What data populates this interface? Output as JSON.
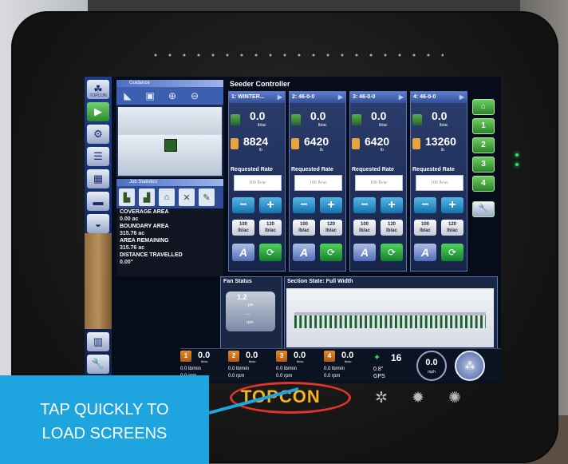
{
  "device": {
    "brand": "TOPCON"
  },
  "left_column": {
    "logo_label": "TOPCON",
    "icons": [
      "topcon-logo-icon",
      "play-icon",
      "tractor-icon",
      "map-layers-icon",
      "calculator-icon",
      "lightbar-icon",
      "tank-icon",
      "ruler-icon",
      "wrench-icon"
    ]
  },
  "guidance": {
    "title": "Guidance"
  },
  "job_stats": {
    "title": "Job Statistics",
    "rows": [
      {
        "label": "COVERAGE AREA",
        "value": "0.00 ac"
      },
      {
        "label": "BOUNDARY AREA",
        "value": "315.76 ac"
      },
      {
        "label": "AREA REMAINING",
        "value": "315.76 ac"
      },
      {
        "label": "DISTANCE TRAVELLED",
        "value": "0.00\""
      }
    ]
  },
  "seeder": {
    "title": "Seeder Controller",
    "requested_rate_label": "Requested Rate",
    "lanes": [
      {
        "name": "1: WINTER...",
        "rate": "0.0",
        "rate_unit": "lb/ac",
        "tank": "8824",
        "tank_unit": "lb",
        "placeholder": "100 lb/ac",
        "preset1": "100\nlb/ac",
        "preset2": "120\nlb/ac"
      },
      {
        "name": "2: 46-0-0",
        "rate": "0.0",
        "rate_unit": "lb/ac",
        "tank": "6420",
        "tank_unit": "lb",
        "placeholder": "100 lb/ac",
        "preset1": "100\nlb/ac",
        "preset2": "120\nlb/ac"
      },
      {
        "name": "3: 46-0-0",
        "rate": "0.0",
        "rate_unit": "lb/ac",
        "tank": "6420",
        "tank_unit": "lb",
        "placeholder": "100 lb/ac",
        "preset1": "100\nlb/ac",
        "preset2": "120\nlb/ac"
      },
      {
        "name": "4: 46-0-0",
        "rate": "0.0",
        "rate_unit": "lb/ac",
        "tank": "13260",
        "tank_unit": "lb",
        "placeholder": "100 lb/ac",
        "preset1": "100\nlb/ac",
        "preset2": "120\nlb/ac"
      }
    ],
    "right_buttons": [
      "1",
      "2",
      "3",
      "4"
    ]
  },
  "fan": {
    "title": "Fan Status",
    "pressure": "1.2",
    "pressure_unit": "psi",
    "rpm_value": "----",
    "rpm_unit": "rpm"
  },
  "section": {
    "title": "Section State: Full Width"
  },
  "status_bar": {
    "channels": [
      {
        "num": "1",
        "value": "0.0",
        "unit": "lb/ac",
        "l1": "0.0 lb/min",
        "l2": "0.0 rpm"
      },
      {
        "num": "2",
        "value": "0.0",
        "unit": "lb/ac",
        "l1": "0.0 lb/min",
        "l2": "0.0 rpm"
      },
      {
        "num": "3",
        "value": "0.0",
        "unit": "lb/ac",
        "l1": "0.0 lb/min",
        "l2": "0.0 rpm"
      },
      {
        "num": "4",
        "value": "0.0",
        "unit": "lb/ac",
        "l1": "0.0 lb/min",
        "l2": "0.0 rpm"
      }
    ],
    "satellites": "16",
    "angle": "0.8\"",
    "gps_label": "GPS",
    "speed": "0.0",
    "speed_unit": "mph"
  },
  "callout": {
    "line1": "TAP QUICKLY TO",
    "line2": "LOAD SCREENS",
    "color": "#1ea5df"
  },
  "colors": {
    "accent": "#3c5fb0",
    "highlight": "#e0342c",
    "logo": "#f5b21e"
  }
}
